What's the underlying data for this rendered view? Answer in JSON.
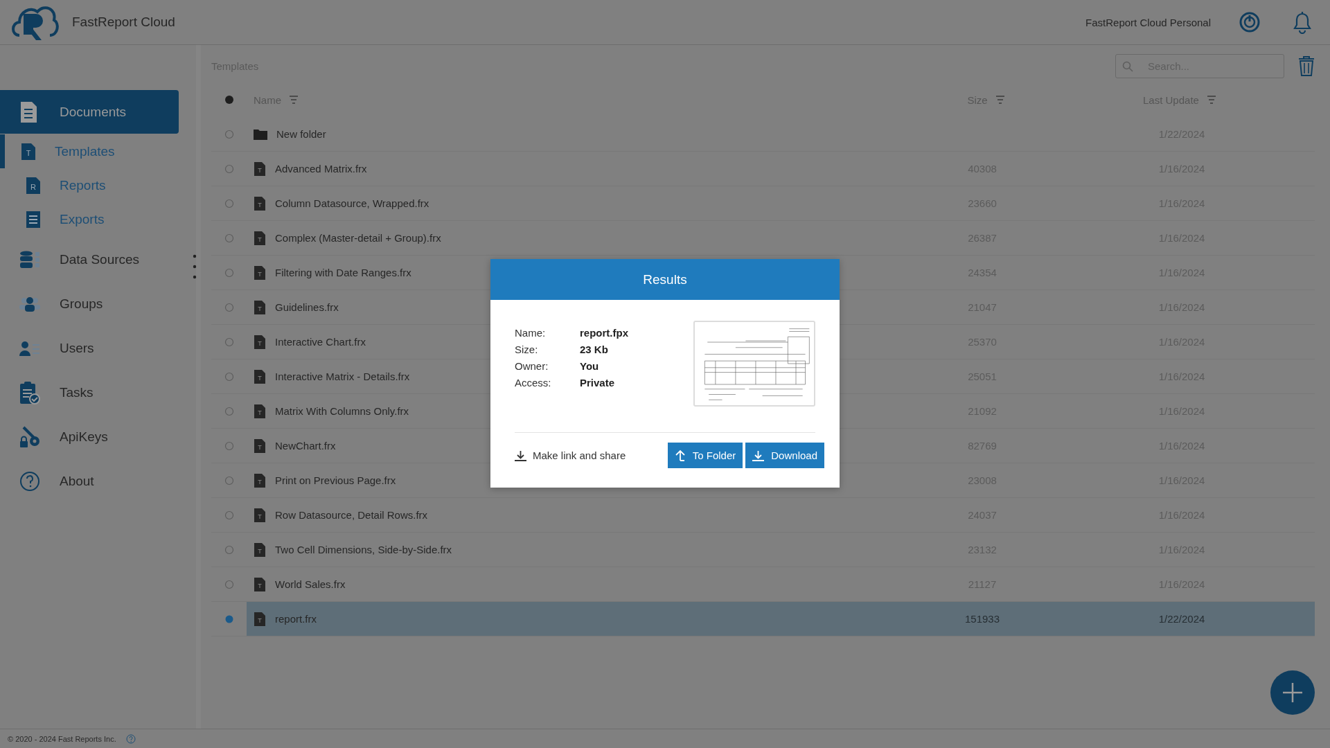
{
  "header": {
    "app_name": "FastReport Cloud",
    "plan": "FastReport Cloud Personal"
  },
  "sidebar": {
    "items": [
      {
        "label": "Documents",
        "selected": true,
        "children": [
          {
            "label": "Templates",
            "icon_letter": "T",
            "selected": true
          },
          {
            "label": "Reports",
            "icon_letter": "R",
            "selected": false
          },
          {
            "label": "Exports",
            "selected": false
          }
        ]
      },
      {
        "label": "Data Sources",
        "selected": false
      },
      {
        "label": "Groups",
        "selected": false
      },
      {
        "label": "Users",
        "selected": false
      },
      {
        "label": "Tasks",
        "selected": false
      },
      {
        "label": "ApiKeys",
        "selected": false
      },
      {
        "label": "About",
        "selected": false
      }
    ]
  },
  "breadcrumb": "Templates",
  "search": {
    "placeholder": "Search..."
  },
  "table": {
    "columns": [
      "Name",
      "Size",
      "Last Update"
    ],
    "rows": [
      {
        "kind": "folder",
        "name": "New folder",
        "size": "",
        "date": "1/22/2024",
        "selected": false
      },
      {
        "kind": "template",
        "icon_letter": "T",
        "name": "Advanced Matrix.frx",
        "size": "40308",
        "date": "1/16/2024",
        "selected": false
      },
      {
        "kind": "template",
        "icon_letter": "T",
        "name": "Column Datasource, Wrapped.frx",
        "size": "23660",
        "date": "1/16/2024",
        "selected": false
      },
      {
        "kind": "template",
        "icon_letter": "T",
        "name": "Complex (Master-detail + Group).frx",
        "size": "26387",
        "date": "1/16/2024",
        "selected": false
      },
      {
        "kind": "template",
        "icon_letter": "T",
        "name": "Filtering with Date Ranges.frx",
        "size": "24354",
        "date": "1/16/2024",
        "selected": false
      },
      {
        "kind": "template",
        "icon_letter": "T",
        "name": "Guidelines.frx",
        "size": "21047",
        "date": "1/16/2024",
        "selected": false
      },
      {
        "kind": "template",
        "icon_letter": "T",
        "name": "Interactive Chart.frx",
        "size": "25370",
        "date": "1/16/2024",
        "selected": false
      },
      {
        "kind": "template",
        "icon_letter": "T",
        "name": "Interactive Matrix - Details.frx",
        "size": "25051",
        "date": "1/16/2024",
        "selected": false
      },
      {
        "kind": "template",
        "icon_letter": "T",
        "name": "Matrix With Columns Only.frx",
        "size": "21092",
        "date": "1/16/2024",
        "selected": false
      },
      {
        "kind": "template",
        "icon_letter": "T",
        "name": "NewChart.frx",
        "size": "82769",
        "date": "1/16/2024",
        "selected": false
      },
      {
        "kind": "template",
        "icon_letter": "T",
        "name": "Print on Previous Page.frx",
        "size": "23008",
        "date": "1/16/2024",
        "selected": false
      },
      {
        "kind": "template",
        "icon_letter": "T",
        "name": "Row Datasource, Detail Rows.frx",
        "size": "24037",
        "date": "1/16/2024",
        "selected": false
      },
      {
        "kind": "template",
        "icon_letter": "T",
        "name": "Two Cell Dimensions, Side-by-Side.frx",
        "size": "23132",
        "date": "1/16/2024",
        "selected": false
      },
      {
        "kind": "template",
        "icon_letter": "T",
        "name": "World Sales.frx",
        "size": "21127",
        "date": "1/16/2024",
        "selected": false
      },
      {
        "kind": "template",
        "icon_letter": "T",
        "name": "report.frx",
        "size": "151933",
        "date": "1/22/2024",
        "selected": true
      }
    ]
  },
  "dialog": {
    "title": "Results",
    "fields": [
      {
        "label": "Name:",
        "value": "report.fpx"
      },
      {
        "label": "Size:",
        "value": "23 Kb"
      },
      {
        "label": "Owner:",
        "value": "You"
      },
      {
        "label": "Access:",
        "value": "Private"
      }
    ],
    "share_link": "Make link and share",
    "buttons": [
      "To Folder",
      "Download"
    ]
  },
  "footer": {
    "copyright": "© 2020 - 2024 Fast Reports Inc."
  }
}
